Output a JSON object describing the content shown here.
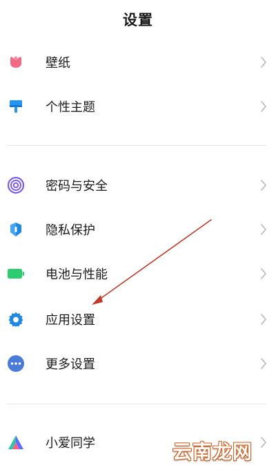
{
  "header": {
    "title": "设置"
  },
  "groups": [
    [
      {
        "label": "壁纸",
        "icon": "wallpaper-icon",
        "color": "#f06a84"
      },
      {
        "label": "个性主题",
        "icon": "theme-brush-icon",
        "color": "#2196f3"
      }
    ],
    [
      {
        "label": "密码与安全",
        "icon": "fingerprint-icon",
        "color": "#7b5ce6"
      },
      {
        "label": "隐私保护",
        "icon": "privacy-shield-icon",
        "color": "#1e88e5"
      },
      {
        "label": "电池与性能",
        "icon": "battery-icon",
        "color": "#2ecc71"
      },
      {
        "label": "应用设置",
        "icon": "gear-icon",
        "color": "#1e88e5"
      },
      {
        "label": "更多设置",
        "icon": "more-dots-icon",
        "color": "#4a7bd8"
      }
    ],
    [
      {
        "label": "小爱同学",
        "icon": "xiaoai-assistant-icon",
        "color": "#6a5cff"
      }
    ]
  ],
  "annotation": {
    "color": "#c0392b",
    "points_to": "应用设置"
  },
  "watermark": {
    "text": "云南龙网"
  }
}
